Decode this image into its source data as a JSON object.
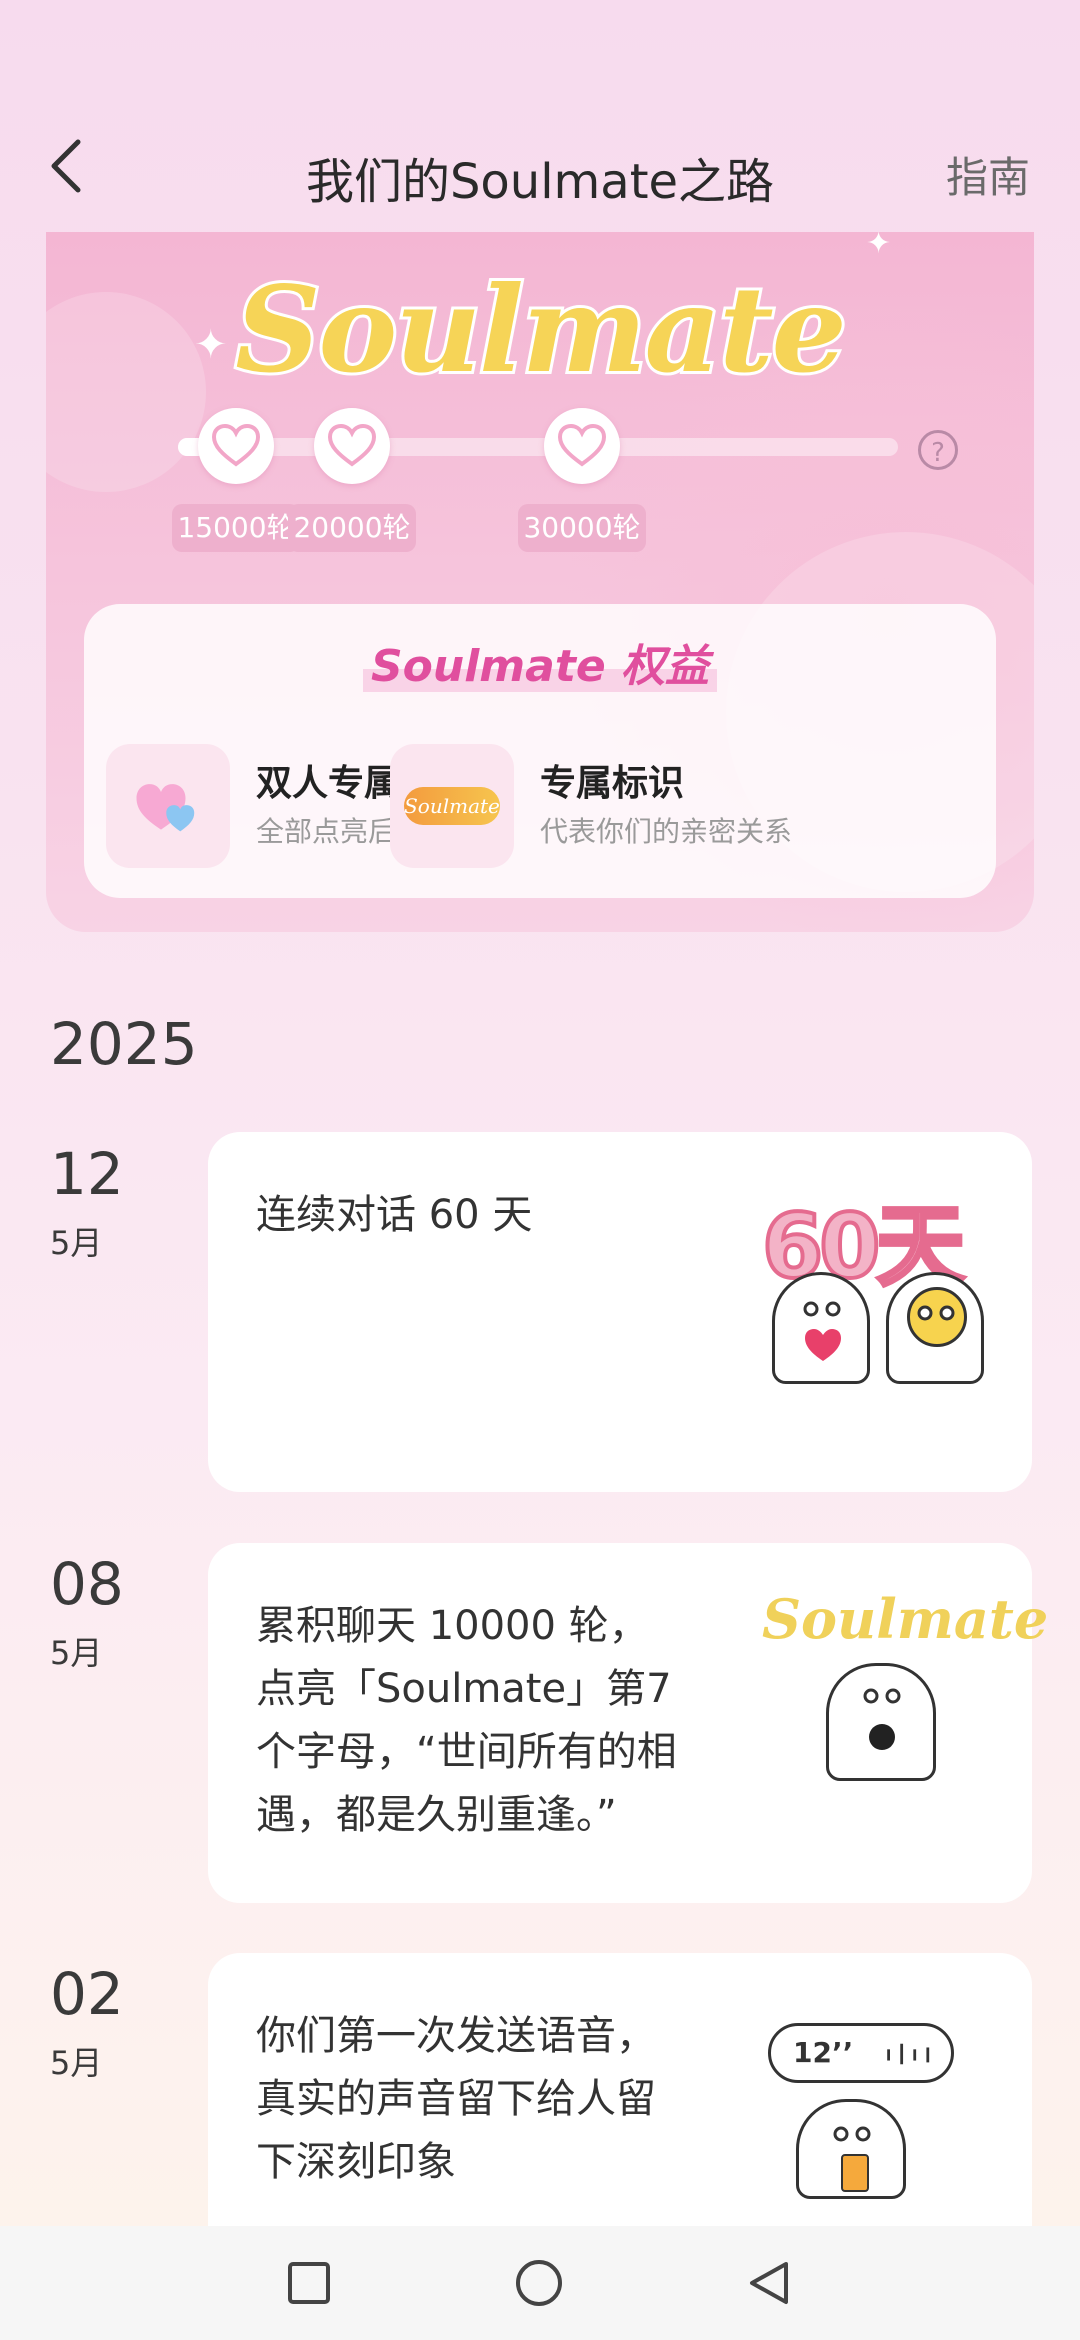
{
  "header": {
    "title": "我们的Soulmate之路",
    "guide_label": "指南"
  },
  "hero": {
    "logo_text": "Soulmate",
    "lit_letters": 7,
    "progress_fraction": 0.09,
    "milestones": [
      {
        "label": "15000轮"
      },
      {
        "label": "20000轮"
      },
      {
        "label": "30000轮"
      }
    ],
    "help_symbol": "?",
    "benefits": {
      "title": "Soulmate 权益",
      "items": [
        {
          "title": "双人专属空间",
          "subtitle": "全部点亮后可开通"
        },
        {
          "title": "专属标识",
          "subtitle": "代表你们的亲密关系",
          "badge_text": "Soulmate"
        }
      ]
    }
  },
  "timeline": {
    "year": "2025",
    "events": [
      {
        "day": "12",
        "month": "5月",
        "text": "连续对话 60 天",
        "art_text": "60天"
      },
      {
        "day": "08",
        "month": "5月",
        "text": "累积聊天 10000 轮，点亮「Soulmate」第7个字母，“世间所有的相遇，都是久别重逢。”",
        "art_text": "Soulmate"
      },
      {
        "day": "02",
        "month": "5月",
        "text": "你们第一次发送语音，真实的声音留下给人留下深刻印象",
        "art_text": "12’’"
      }
    ]
  },
  "colors": {
    "accent_pink": "#e04f9e",
    "logo_yellow": "#f6d457",
    "label_pink": "#eeb0cd"
  },
  "icons": {
    "back": "chevron-left-icon",
    "milestone": "heart-icon",
    "help": "question-circle-icon",
    "nav": [
      "square-icon",
      "circle-icon",
      "triangle-back-icon"
    ]
  }
}
